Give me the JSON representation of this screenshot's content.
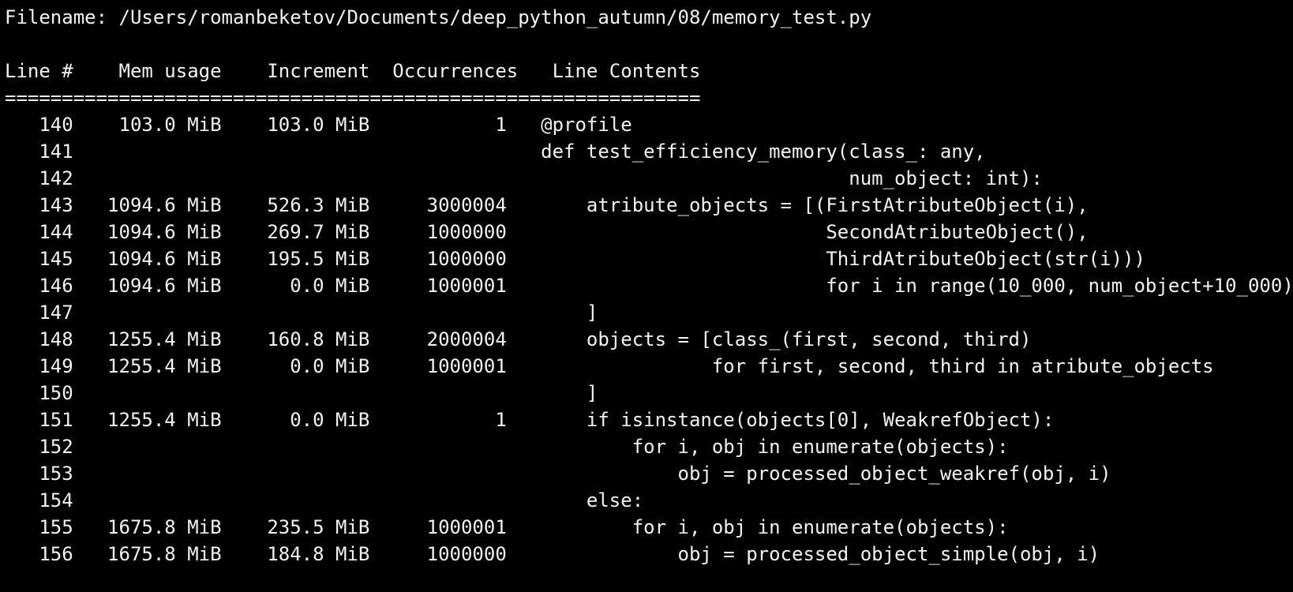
{
  "terminal": {
    "clipped_line": "                                        ",
    "lines": [
      "Filename: /Users/romanbeketov/Documents/deep_python_autumn/08/memory_test.py",
      "",
      "Line #    Mem usage    Increment  Occurrences   Line Contents",
      "=============================================================",
      "   140    103.0 MiB    103.0 MiB           1   @profile",
      "   141                                         def test_efficiency_memory(class_: any,",
      "   142                                                                    num_object: int):",
      "   143   1094.6 MiB    526.3 MiB     3000004       atribute_objects = [(FirstAtributeObject(i),",
      "   144   1094.6 MiB    269.7 MiB     1000000                            SecondAtributeObject(),",
      "   145   1094.6 MiB    195.5 MiB     1000000                            ThirdAtributeObject(str(i)))",
      "   146   1094.6 MiB      0.0 MiB     1000001                            for i in range(10_000, num_object+10_000)",
      "   147                                             ]",
      "   148   1255.4 MiB    160.8 MiB     2000004       objects = [class_(first, second, third)",
      "   149   1255.4 MiB      0.0 MiB     1000001                  for first, second, third in atribute_objects",
      "   150                                             ]",
      "   151   1255.4 MiB      0.0 MiB           1       if isinstance(objects[0], WeakrefObject):",
      "   152                                                 for i, obj in enumerate(objects):",
      "   153                                                     obj = processed_object_weakref(obj, i)",
      "   154                                             else:",
      "   155   1675.8 MiB    235.5 MiB     1000001           for i, obj in enumerate(objects):",
      "   156   1675.8 MiB    184.8 MiB     1000000               obj = processed_object_simple(obj, i)"
    ]
  }
}
